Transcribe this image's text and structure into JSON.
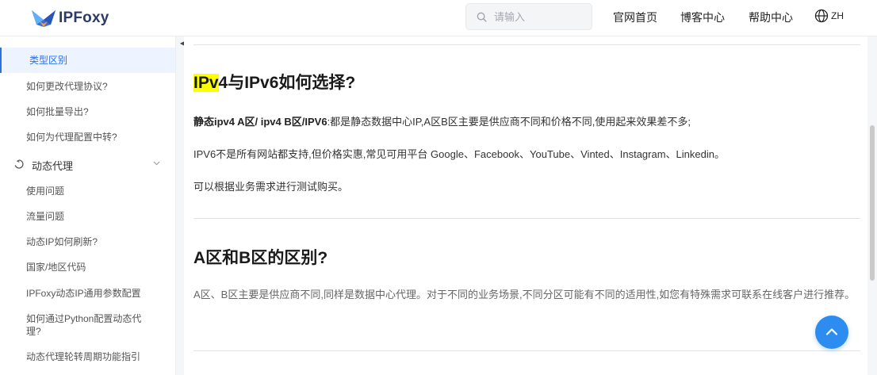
{
  "header": {
    "logo_text": "IPFoxy",
    "search_placeholder": "请输入",
    "nav": [
      "官网首页",
      "博客中心",
      "帮助中心"
    ],
    "lang": "ZH"
  },
  "sidebar": {
    "items": [
      "类型区别",
      "如何更改代理协议?",
      "如何批量导出?",
      "如何为代理配置中转?"
    ],
    "section": "动态代理",
    "sub_items": [
      "使用问题",
      "流量问题",
      "动态IP如何刷新?",
      "国家/地区代码",
      "IPFoxy动态IP通用参数配置",
      "如何通过Python配置动态代理?",
      "动态代理轮转周期功能指引"
    ]
  },
  "main": {
    "section1": {
      "title_highlight": "IPv",
      "title_rest": "4与IPv6如何选择?",
      "p1_bold": "静态ipv4 A区/ ipv4 B区/IPV6",
      "p1_text": ":都是静态数据中心IP,A区B区主要是供应商不同和价格不同,使用起来效果差不多;",
      "p2": "IPV6不是所有网站都支持,但价格实惠,常见可用平台 Google、Facebook、YouTube、Vinted、Instagram、Linkedin。",
      "p3": "可以根据业务需求进行测试购买。"
    },
    "section2": {
      "title": "A区和B区的区别?",
      "p1": "A区、B区主要是供应商不同,同样是数据中心代理。对于不同的业务场景,不同分区可能有不同的适用性,如您有特殊需求可联系在线客户进行推荐。"
    }
  },
  "colors": {
    "accent": "#2f6fe4",
    "back_to_top": "#2d8cf0",
    "highlight": "#ffff00"
  }
}
